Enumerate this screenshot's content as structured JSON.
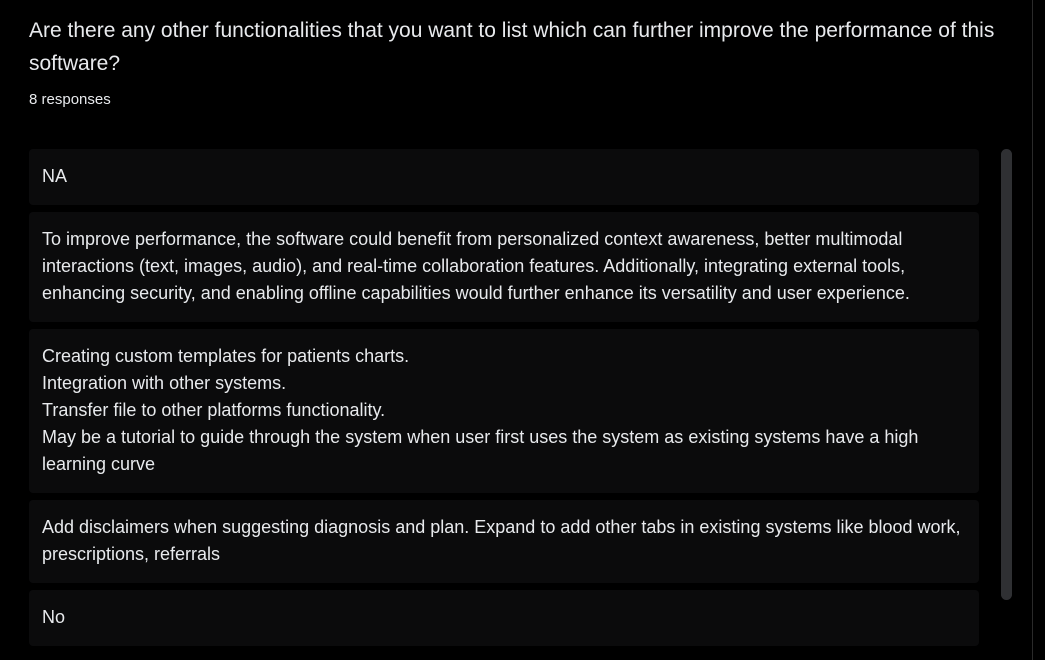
{
  "question": {
    "title": "Are there any other functionalities that you want to list which can further improve the performance of this software?",
    "response_count": "8 responses"
  },
  "responses": [
    "NA",
    "To improve performance, the software could benefit from personalized context awareness, better multimodal interactions (text, images, audio), and real-time collaboration features. Additionally, integrating external tools, enhancing security, and enabling offline capabilities would further enhance its versatility and user experience.",
    "Creating custom templates for patients charts.\nIntegration with other systems.\nTransfer file to other platforms functionality.\nMay be a tutorial to guide through the system when user first uses the system as existing systems have a high learning curve",
    "Add disclaimers when suggesting diagnosis and plan. Expand to add other tabs in existing systems like blood work, prescriptions, referrals",
    "No"
  ],
  "colors": {
    "background": "#000000",
    "response_card": "#0b0b0c",
    "text": "#e8eaed",
    "scrollbar_thumb": "#2f3033"
  }
}
